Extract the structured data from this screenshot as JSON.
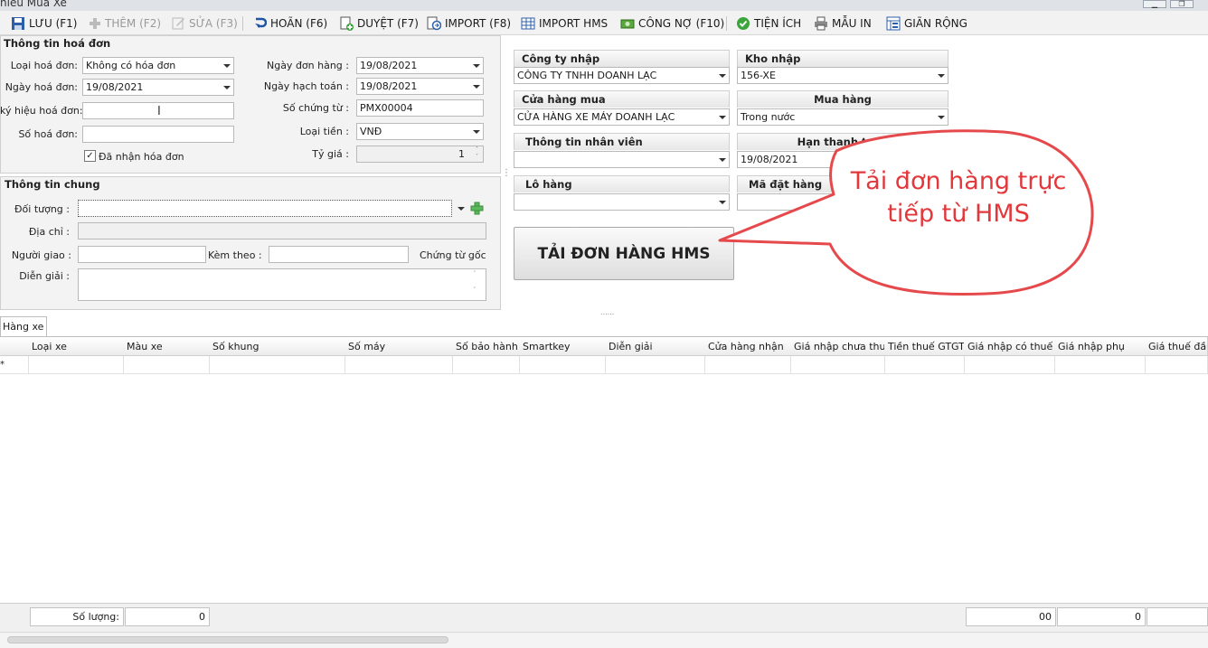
{
  "window": {
    "title": "hieu Mua Xe",
    "min": "▁",
    "restore": "❐"
  },
  "toolbar": {
    "save": "LƯU (F1)",
    "add": "THÊM (F2)",
    "edit": "SỬA (F3)",
    "undo": "HOÃN (F6)",
    "approve": "DUYỆT (F7)",
    "import": "IMPORT (F8)",
    "import_hms": "IMPORT HMS",
    "debt": "CÔNG NỢ (F10)",
    "utility": "TIỆN ÍCH",
    "print": "MẪU IN",
    "expand": "GIÃN RỘNG"
  },
  "invoice": {
    "title": "Thông tin hoá đơn",
    "type_label": "Loại hoá đơn:",
    "type_value": "Không có hóa đơn",
    "date_label": "Ngày hoá đơn:",
    "date_value": "19/08/2021",
    "symbol_label": "ký hiệu hoá đơn:",
    "symbol_value": "",
    "number_label": "Số hoá đơn:",
    "number_value": "",
    "received_label": "Đã nhận hóa đơn",
    "received_mark": "✓",
    "order_date_label": "Ngày đơn hàng :",
    "order_date_value": "19/08/2021",
    "account_date_label": "Ngày hạch toán :",
    "account_date_value": "19/08/2021",
    "voucher_label": "Số chứng từ :",
    "voucher_value": "PMX00004",
    "currency_label": "Loại tiền :",
    "currency_value": "VNĐ",
    "rate_label": "Tỷ giá :",
    "rate_value": "1",
    "spin_up": "˄",
    "spin_down": "˅"
  },
  "general": {
    "title": "Thông tin chung",
    "object_label": "Đối tượng :",
    "object_value": "",
    "address_label": "Địa chỉ :",
    "address_value": "",
    "deliverer_label": "Người giao :",
    "deliverer_value": "",
    "attach_label": "Kèm theo :",
    "attach_value": "",
    "original_label": "Chứng từ gốc",
    "desc_label": "Diễn giải :",
    "desc_value": "",
    "cursor": "I"
  },
  "right": {
    "company_label": "Công ty nhập",
    "company_value": "CÔNG TY TNHH DOANH LẠC",
    "warehouse_label": "Kho nhập",
    "warehouse_value": "156-XE",
    "store_label": "Cửa hàng mua",
    "store_value": "CỬA HÀNG XE MÁY DOANH LẠC",
    "purchase_label": "Mua hàng",
    "purchase_value": "Trong nước",
    "staff_label": "Thông tin nhân viên",
    "staff_value": "",
    "due_label": "Hạn thanh toán",
    "due_value": "19/08/2021",
    "lot_label": "Lô hàng",
    "lot_value": "",
    "order_code_label": "Mã đặt hàng",
    "order_code_value": "",
    "hms_button": "TẢI ĐƠN HÀNG HMS"
  },
  "callout": {
    "text": "Tải đơn hàng trực tiếp từ HMS",
    "color": "#e3383b"
  },
  "tabs": {
    "vehicles": "Hàng xe"
  },
  "grid": {
    "row_marker": "*",
    "columns": [
      "Loại xe",
      "Màu xe",
      "Số khung",
      "Số máy",
      "Số bảo hành",
      "Smartkey",
      "Diễn giải",
      "Cửa hàng nhận",
      "Giá nhập chưa thuế",
      "Tiền thuế GTGT",
      "Giá nhập có thuế",
      "Giá nhập phụ",
      "Giá thuế đầu vào"
    ]
  },
  "footer": {
    "qty_label": "Số lượng:",
    "qty_value": "0",
    "total1": "00",
    "total2": "0"
  },
  "splitter": {
    "dots_h": "......",
    "dots_v": "⋮"
  }
}
